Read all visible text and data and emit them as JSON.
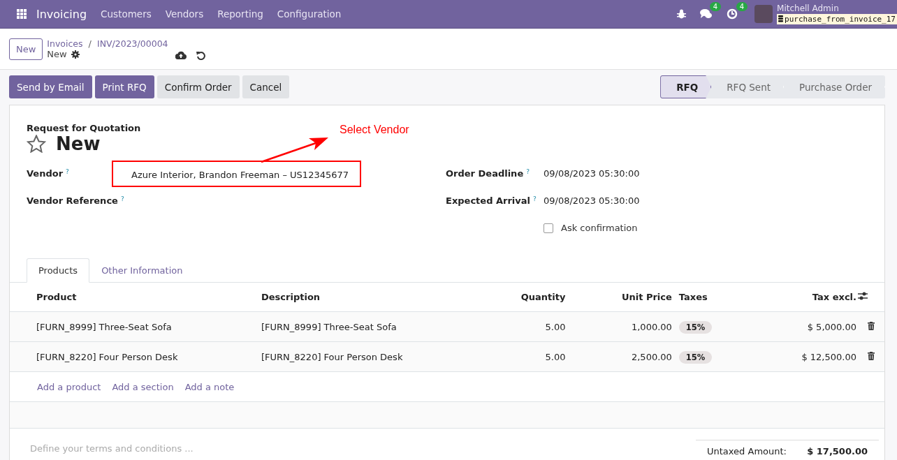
{
  "navbar": {
    "app_name": "Invoicing",
    "menu": [
      "Customers",
      "Vendors",
      "Reporting",
      "Configuration"
    ],
    "messages_count": "4",
    "activities_count": "4",
    "user_name": "Mitchell Admin",
    "database": "purchase_from_invoice_17"
  },
  "control_panel": {
    "new_button": "New",
    "breadcrumbs": [
      "Invoices",
      "INV/2023/00004"
    ],
    "separator": "/",
    "current": "New"
  },
  "action_buttons": [
    {
      "label": "Send by Email",
      "kind": "primary"
    },
    {
      "label": "Print RFQ",
      "kind": "primary"
    },
    {
      "label": "Confirm Order",
      "kind": "secondary"
    },
    {
      "label": "Cancel",
      "kind": "secondary"
    }
  ],
  "status_steps": [
    {
      "label": "RFQ",
      "selected": true
    },
    {
      "label": "RFQ Sent",
      "selected": false
    },
    {
      "label": "Purchase Order",
      "selected": false
    }
  ],
  "form": {
    "subtitle": "Request for Quotation",
    "title": "New",
    "starred": false,
    "annotation": "Select Vendor",
    "left_fields": [
      {
        "label": "Vendor",
        "help": "?",
        "value": "Azure Interior, Brandon Freeman – US12345677",
        "highlighted": true
      },
      {
        "label": "Vendor Reference",
        "help": "?",
        "highlighted": false
      }
    ],
    "right_fields": [
      {
        "label": "Order Deadline",
        "help": "?",
        "value": "09/08/2023 05:30:00"
      },
      {
        "label": "Expected Arrival",
        "help": "?",
        "value": "09/08/2023 05:30:00"
      }
    ],
    "ask_confirmation": {
      "label": "Ask confirmation",
      "checked": false
    }
  },
  "tabs": [
    {
      "label": "Products",
      "selected": true
    },
    {
      "label": "Other Information",
      "selected": false
    }
  ],
  "table": {
    "columns": [
      "Product",
      "Description",
      "Quantity",
      "Unit Price",
      "Taxes",
      "Tax excl."
    ],
    "rows": [
      {
        "product": "[FURN_8999] Three-Seat Sofa",
        "description": "[FURN_8999] Three-Seat Sofa",
        "quantity": "5.00",
        "unit_price": "1,000.00",
        "tax": "15%",
        "subtotal": "$ 5,000.00"
      },
      {
        "product": "[FURN_8220] Four Person Desk",
        "description": "[FURN_8220] Four Person Desk",
        "quantity": "5.00",
        "unit_price": "2,500.00",
        "tax": "15%",
        "subtotal": "$ 12,500.00"
      }
    ],
    "add_links": [
      "Add a product",
      "Add a section",
      "Add a note"
    ]
  },
  "terms": {
    "placeholder": "Define your terms and conditions ..."
  },
  "totals": {
    "label": "Untaxed Amount:",
    "value": "$ 17,500.00"
  }
}
